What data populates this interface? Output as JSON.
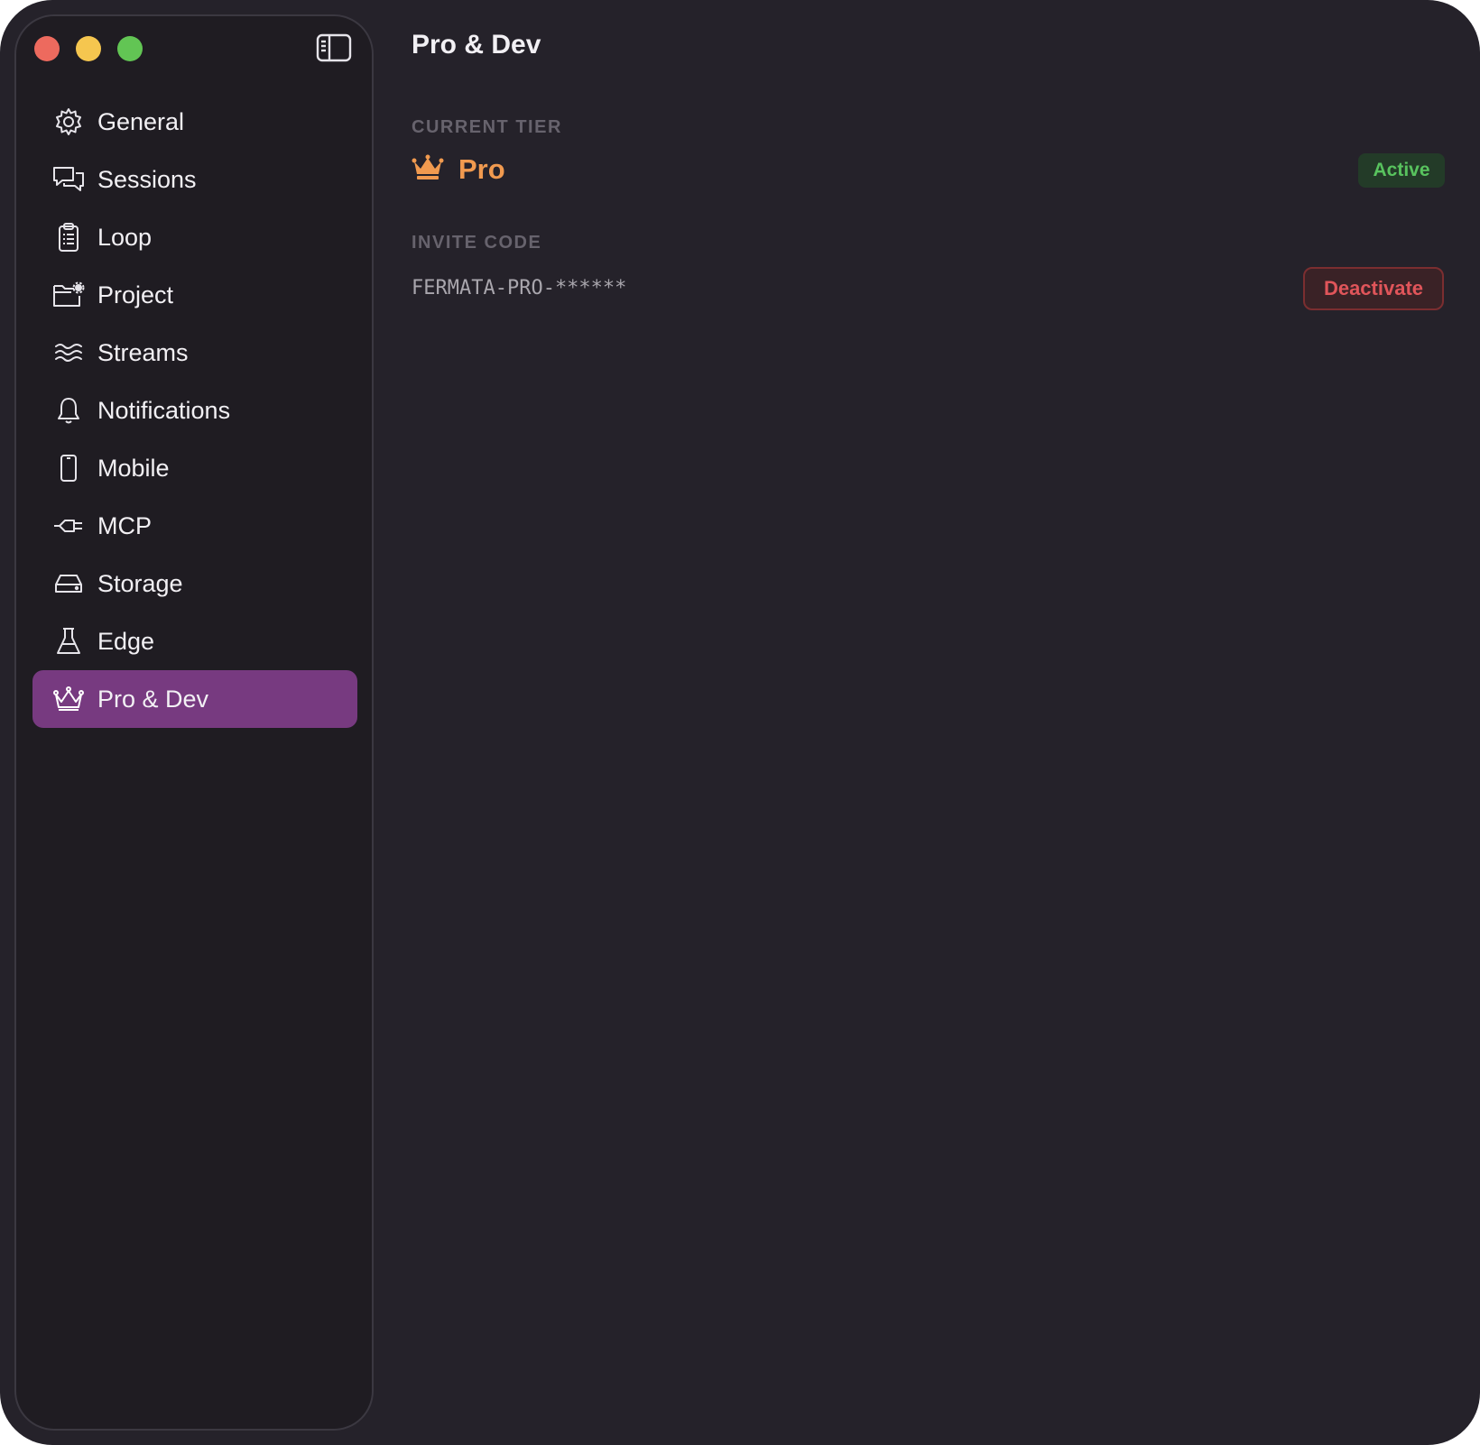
{
  "sidebar": {
    "items": [
      {
        "label": "General",
        "icon": "gear-icon"
      },
      {
        "label": "Sessions",
        "icon": "chat-bubbles-icon"
      },
      {
        "label": "Loop",
        "icon": "clipboard-icon"
      },
      {
        "label": "Project",
        "icon": "folder-gear-icon"
      },
      {
        "label": "Streams",
        "icon": "waves-icon"
      },
      {
        "label": "Notifications",
        "icon": "bell-icon"
      },
      {
        "label": "Mobile",
        "icon": "phone-icon"
      },
      {
        "label": "MCP",
        "icon": "plug-icon"
      },
      {
        "label": "Storage",
        "icon": "drive-icon"
      },
      {
        "label": "Edge",
        "icon": "flask-icon"
      },
      {
        "label": "Pro & Dev",
        "icon": "crown-icon",
        "active": true
      }
    ]
  },
  "main": {
    "title": "Pro & Dev",
    "current_tier": {
      "section_label": "CURRENT TIER",
      "tier_name": "Pro",
      "status": "Active"
    },
    "invite_code": {
      "section_label": "INVITE CODE",
      "value": "FERMATA-PRO-******",
      "deactivate_label": "Deactivate"
    }
  },
  "colors": {
    "window_bg": "#25222a",
    "sidebar_bg": "#1f1c22",
    "active_item_bg": "#773a80",
    "tier_accent": "#f19a4f",
    "active_green": "#58c35e",
    "danger_red": "#e0555a"
  }
}
